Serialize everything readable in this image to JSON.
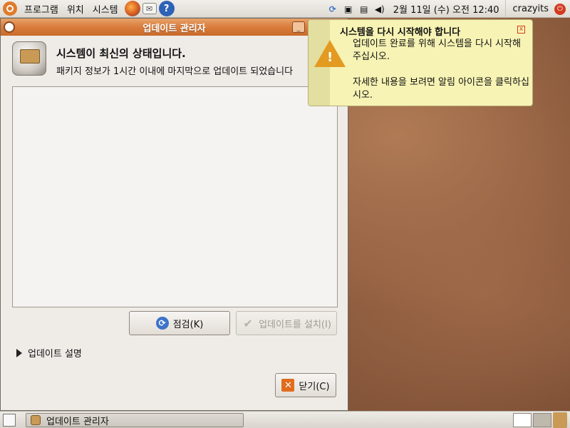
{
  "top_panel": {
    "menus": [
      "프로그램",
      "위치",
      "시스템"
    ],
    "clock": "2월 11일 (수) 오전 12:40",
    "user": "crazyits"
  },
  "window": {
    "title": "업데이트 관리자",
    "header_title": "시스템이 최신의 상태입니다.",
    "header_subtitle": "패키지 정보가 1시간 이내에 마지막으로 업데이트 되었습니다",
    "check_button": "점검(K)",
    "install_button": "업데이트를 설치(I)",
    "expander_label": "업데이트 설명",
    "close_button": "닫기(C)"
  },
  "notification": {
    "title": "시스템을 다시 시작해야 합니다",
    "body1": "업데이트 완료를 위해 시스템을 다시 시작해 주십시오.",
    "body2": "자세한 내용을 보려면 알림 아이콘을 클릭하십시오."
  },
  "taskbar": {
    "task_label": "업데이트 관리자"
  },
  "colors": {
    "accent": "#d97c3c",
    "notification_bg": "#f7f3b4",
    "warning": "#e39a21"
  }
}
